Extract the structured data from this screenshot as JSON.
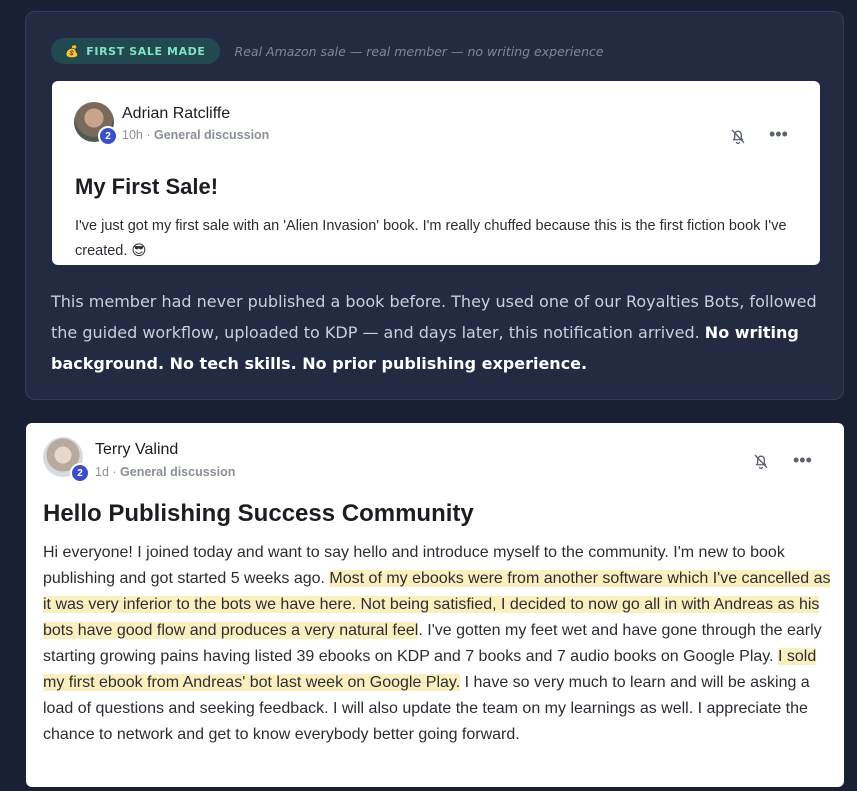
{
  "featured": {
    "badge_icon": "money-bag-icon",
    "badge_label": "FIRST SALE MADE",
    "caption": "Real Amazon sale — real member — no writing experience",
    "post": {
      "author": "Adrian Ratcliffe",
      "level": "2",
      "time": "10h",
      "separator": "·",
      "category": "General discussion",
      "title": "My First Sale!",
      "body": "I've just got my first sale with an 'Alien Invasion' book. I'm really chuffed because this is the first fiction book I've created. 😎"
    },
    "summary_plain": "This member had never published a book before. They used one of our Royalties Bots, followed the guided workflow, uploaded to KDP — and days later, this notification arrived. ",
    "summary_bold": "No writing background. No tech skills. No prior publishing experience."
  },
  "post2": {
    "author": "Terry Valind",
    "level": "2",
    "time": "1d",
    "separator": "·",
    "category": "General discussion",
    "title": "Hello Publishing Success Community",
    "body_1": "Hi everyone! I joined today and want to say hello and introduce myself to the community. I'm new to book publishing and got started 5 weeks ago. ",
    "body_hl_1": "Most of my ebooks were from another software which I've cancelled as it was very inferior to the bots we have here. Not being satisfied, I decided to now go all in with Andreas as his bots have good flow and produces a very natural feel",
    "body_2": ". I've gotten my feet wet and have gone through the early starting growing pains having listed 39 ebooks on KDP and 7 books and 7 audio books on Google Play. ",
    "body_hl_2": "I sold my first ebook from Andreas' bot last week on Google Play.",
    "body_3": " I have so very much to learn and will be asking a load of questions and seeking feedback. I will also update the team on my learnings as well. I appreciate the chance to network and get to know everybody better going forward."
  },
  "icons": {
    "bell": "bell-off-icon",
    "more": "more-horizontal-icon"
  },
  "colors": {
    "page_bg": "#1a2033",
    "card_bg": "#232b43",
    "badge_bg": "#22494f",
    "badge_text": "#7fe3c8",
    "highlight": "#fcefbf",
    "level_badge": "#3a4fc7"
  }
}
